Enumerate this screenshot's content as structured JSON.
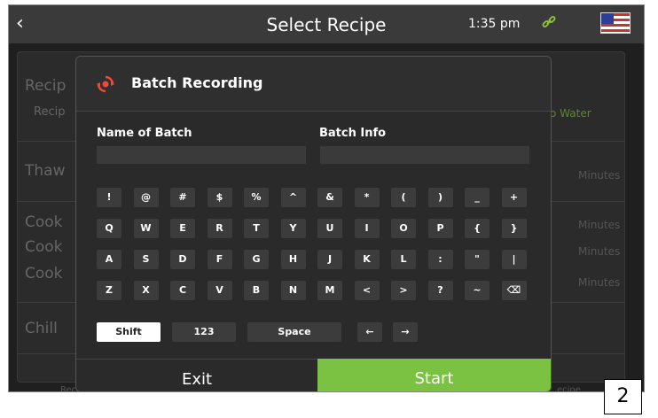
{
  "topbar": {
    "back_glyph": "‹",
    "title": "Select Recipe",
    "time": "1:35 pm",
    "link_icon": "link-icon",
    "flag_icon": "us-flag-icon"
  },
  "background": {
    "recipe_label": "Recip",
    "recipe_sub": "Recip",
    "water": "o Water",
    "thaw": "Thaw",
    "cook1": "Cook",
    "cook2": "Cook",
    "cook3": "Cook",
    "chill": "Chill",
    "minutes": [
      "Minutes",
      "Minutes",
      "Minutes",
      "Minutes"
    ],
    "bottom_left": "Rec",
    "bottom_right": "ecipe"
  },
  "modal": {
    "title": "Batch Recording",
    "icon": "record-sync-icon",
    "name_label": "Name of Batch",
    "info_label": "Batch Info",
    "name_value": "",
    "info_value": "",
    "keyboard": {
      "row1": [
        "!",
        "@",
        "#",
        "$",
        "%",
        "^",
        "&",
        "*",
        "(",
        ")",
        "_",
        "+"
      ],
      "row2": [
        "Q",
        "W",
        "E",
        "R",
        "T",
        "Y",
        "U",
        "I",
        "O",
        "P",
        "{",
        "}"
      ],
      "row3": [
        "A",
        "S",
        "D",
        "F",
        "G",
        "H",
        "J",
        "K",
        "L",
        ":",
        "\"",
        "|"
      ],
      "row4": [
        "Z",
        "X",
        "C",
        "V",
        "B",
        "N",
        "M",
        "<",
        ">",
        "?",
        "~",
        "⌫"
      ],
      "shift": "Shift",
      "num": "123",
      "space": "Space",
      "left": "←",
      "right": "→"
    },
    "exit": "Exit",
    "start": "Start"
  },
  "badge": "2"
}
